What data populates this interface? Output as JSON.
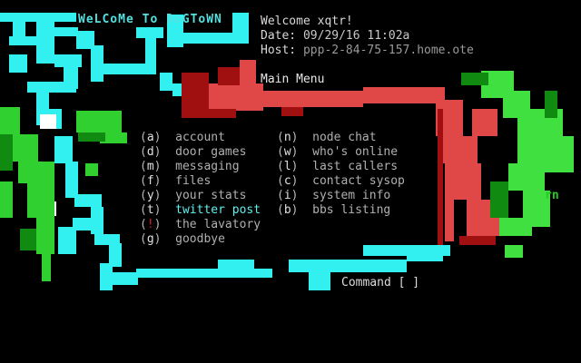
{
  "banner": "WeLCoMe To DoGToWN",
  "header": {
    "welcome_label": "Welcome",
    "user": "xqtr!",
    "date_label": "Date:",
    "date_value": "09/29/16 11:02a",
    "host_label": "Host:",
    "host_value": "ppp-2-84-75-157.home.ote"
  },
  "menu": {
    "title": "Main Menu",
    "left": [
      {
        "key": "a",
        "label": "account"
      },
      {
        "key": "d",
        "label": "door games"
      },
      {
        "key": "m",
        "label": "messaging"
      },
      {
        "key": "f",
        "label": "files"
      },
      {
        "key": "y",
        "label": "your stats"
      },
      {
        "key": "t",
        "label": "twitter post",
        "highlight": true
      },
      {
        "key": "!",
        "label": "the lavatory"
      },
      {
        "key": "g",
        "label": "goodbye"
      }
    ],
    "right": [
      {
        "key": "n",
        "label": "node chat"
      },
      {
        "key": "w",
        "label": "who's online"
      },
      {
        "key": "l",
        "label": "last callers"
      },
      {
        "key": "c",
        "label": "contact sysop"
      },
      {
        "key": "i",
        "label": "system info"
      },
      {
        "key": "b",
        "label": "bbs listing"
      }
    ]
  },
  "prompt": {
    "label": "Command [ ]"
  },
  "art_signature": "rn",
  "colors": {
    "cyan": "#33f0f0",
    "red": "#e04848",
    "dark_red": "#a81010",
    "green": "#40e040",
    "dark_green": "#10a010",
    "highlight": "#5ff0f0"
  }
}
